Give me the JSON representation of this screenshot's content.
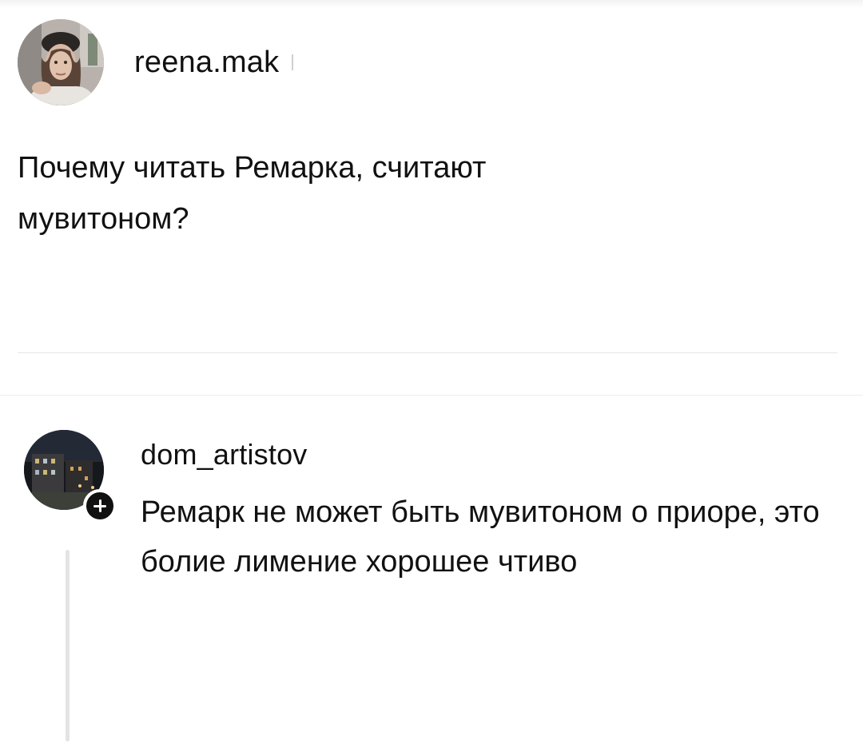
{
  "post": {
    "username": "reena.mak",
    "text": "Почему читать Ремарка, считают мувитоном?"
  },
  "comment": {
    "username": "dom_artistov",
    "text": "Ремарк не может быть мувитоном о приоре, это болие лимение хорошее чтиво"
  },
  "colors": {
    "text": "#111111",
    "background": "#ffffff",
    "divider": "#e6e6e6",
    "badge": "#111111"
  },
  "icons": {
    "follow_badge": "plus-icon"
  }
}
